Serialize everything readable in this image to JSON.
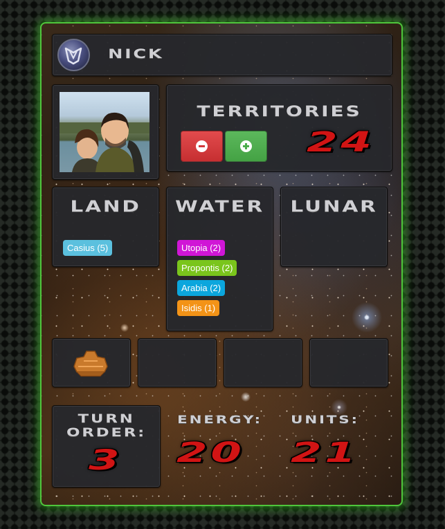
{
  "player": {
    "name": "Nick",
    "emblem_icon": "faction-emblem-icon",
    "photo_icon": "player-photo"
  },
  "territories": {
    "title": "Territories",
    "count": "24",
    "decrement_icon": "minus-circle-icon",
    "increment_icon": "plus-circle-icon"
  },
  "land": {
    "title": "Land",
    "items": [
      {
        "label": "Casius (5)",
        "color": "#5bc0de"
      }
    ]
  },
  "water": {
    "title": "Water",
    "items": [
      {
        "label": "Utopia (2)",
        "color": "#d016d6"
      },
      {
        "label": "Propontis (2)",
        "color": "#7ac51c"
      },
      {
        "label": "Arabia (2)",
        "color": "#0ba6dd"
      },
      {
        "label": "Isidis (1)",
        "color": "#f39317"
      }
    ]
  },
  "lunar": {
    "title": "Lunar",
    "items": []
  },
  "slots": [
    {
      "icon": "unit-token-icon"
    },
    {
      "icon": ""
    },
    {
      "icon": ""
    },
    {
      "icon": ""
    }
  ],
  "turn_order": {
    "label_line1": "Turn",
    "label_line2": "Order:",
    "value": "3"
  },
  "energy": {
    "label": "Energy:",
    "value": "20"
  },
  "units": {
    "label": "Units:",
    "value": "21"
  },
  "colors": {
    "accent_green": "#4fc63c",
    "counter_red": "#d11414",
    "minus_button": "#d9383a",
    "plus_button": "#4cae4c"
  }
}
